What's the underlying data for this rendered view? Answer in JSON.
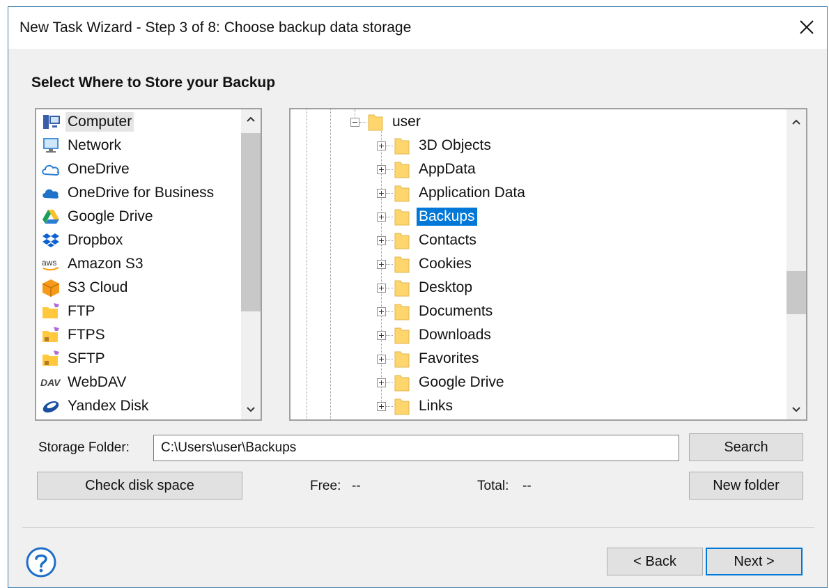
{
  "window": {
    "title": "New Task Wizard - Step 3 of 8: Choose backup data storage"
  },
  "heading": "Select Where to Store your Backup",
  "storage_types": [
    {
      "label": "Computer",
      "icon": "computer-icon",
      "selected": true
    },
    {
      "label": "Network",
      "icon": "network-icon"
    },
    {
      "label": "OneDrive",
      "icon": "onedrive-icon"
    },
    {
      "label": "OneDrive for Business",
      "icon": "onedrive-business-icon"
    },
    {
      "label": "Google Drive",
      "icon": "google-drive-icon"
    },
    {
      "label": "Dropbox",
      "icon": "dropbox-icon"
    },
    {
      "label": "Amazon S3",
      "icon": "aws-icon",
      "icon_text": "aws"
    },
    {
      "label": "S3 Cloud",
      "icon": "s3-cloud-icon"
    },
    {
      "label": "FTP",
      "icon": "ftp-folder-icon"
    },
    {
      "label": "FTPS",
      "icon": "ftps-folder-icon"
    },
    {
      "label": "SFTP",
      "icon": "sftp-folder-icon"
    },
    {
      "label": "WebDAV",
      "icon": "webdav-icon",
      "icon_text": "DAV"
    },
    {
      "label": "Yandex Disk",
      "icon": "yandex-disk-icon"
    }
  ],
  "folder_tree": {
    "parent": "user",
    "children": [
      {
        "label": "3D Objects"
      },
      {
        "label": "AppData"
      },
      {
        "label": "Application Data"
      },
      {
        "label": "Backups",
        "selected": true
      },
      {
        "label": "Contacts"
      },
      {
        "label": "Cookies"
      },
      {
        "label": "Desktop"
      },
      {
        "label": "Documents"
      },
      {
        "label": "Downloads"
      },
      {
        "label": "Favorites"
      },
      {
        "label": "Google Drive"
      },
      {
        "label": "Links"
      }
    ]
  },
  "storage_folder": {
    "label": "Storage Folder:",
    "value": "C:\\Users\\user\\Backups"
  },
  "buttons": {
    "search": "Search",
    "check_disk": "Check disk space",
    "new_folder": "New folder",
    "back": "< Back",
    "next": "Next >"
  },
  "disk": {
    "free_label": "Free:",
    "free_value": "--",
    "total_label": "Total:",
    "total_value": "--"
  },
  "colors": {
    "accent": "#0078d7",
    "folder": "#ffd66e",
    "selection_gray": "#e5e5e5",
    "help_blue": "#1e6fc8"
  }
}
